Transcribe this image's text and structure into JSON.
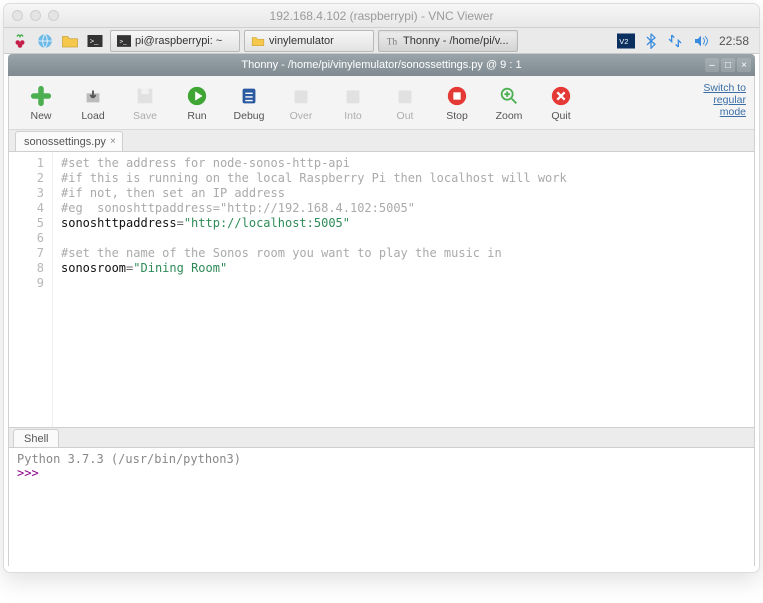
{
  "mac_title": "192.168.4.102 (raspberrypi) - VNC Viewer",
  "taskbar": {
    "items": [
      {
        "label": "pi@raspberrypi: ~"
      },
      {
        "label": "vinylemulator"
      },
      {
        "label": "Thonny  -  /home/pi/v..."
      }
    ],
    "time": "22:58"
  },
  "thonny": {
    "title": "Thonny  -  /home/pi/vinylemulator/sonossettings.py  @  9 : 1",
    "switch_link": "Switch to\nregular\nmode",
    "tools": {
      "new": "New",
      "load": "Load",
      "save": "Save",
      "run": "Run",
      "debug": "Debug",
      "over": "Over",
      "into": "Into",
      "out": "Out",
      "stop": "Stop",
      "zoom": "Zoom",
      "quit": "Quit"
    },
    "tab": {
      "label": "sonossettings.py",
      "close": "×"
    },
    "code": {
      "lines": [
        {
          "n": 1,
          "type": "comment",
          "text": "#set the address for node-sonos-http-api"
        },
        {
          "n": 2,
          "type": "comment",
          "text": "#if this is running on the local Raspberry Pi then localhost will work"
        },
        {
          "n": 3,
          "type": "comment",
          "text": "#if not, then set an IP address"
        },
        {
          "n": 4,
          "type": "comment",
          "text": "#eg  sonoshttpaddress=\"http://192.168.4.102:5005\""
        },
        {
          "n": 5,
          "type": "assign",
          "id": "sonoshttpaddress",
          "eq": "=",
          "str": "\"http://localhost:5005\""
        },
        {
          "n": 6,
          "type": "blank",
          "text": ""
        },
        {
          "n": 7,
          "type": "comment",
          "text": "#set the name of the Sonos room you want to play the music in"
        },
        {
          "n": 8,
          "type": "assign",
          "id": "sonosroom",
          "eq": "=",
          "str": "\"Dining Room\""
        },
        {
          "n": 9,
          "type": "blank",
          "text": ""
        }
      ]
    },
    "shell": {
      "tab": "Shell",
      "info": "Python 3.7.3 (/usr/bin/python3)",
      "prompt": ">>>"
    }
  }
}
